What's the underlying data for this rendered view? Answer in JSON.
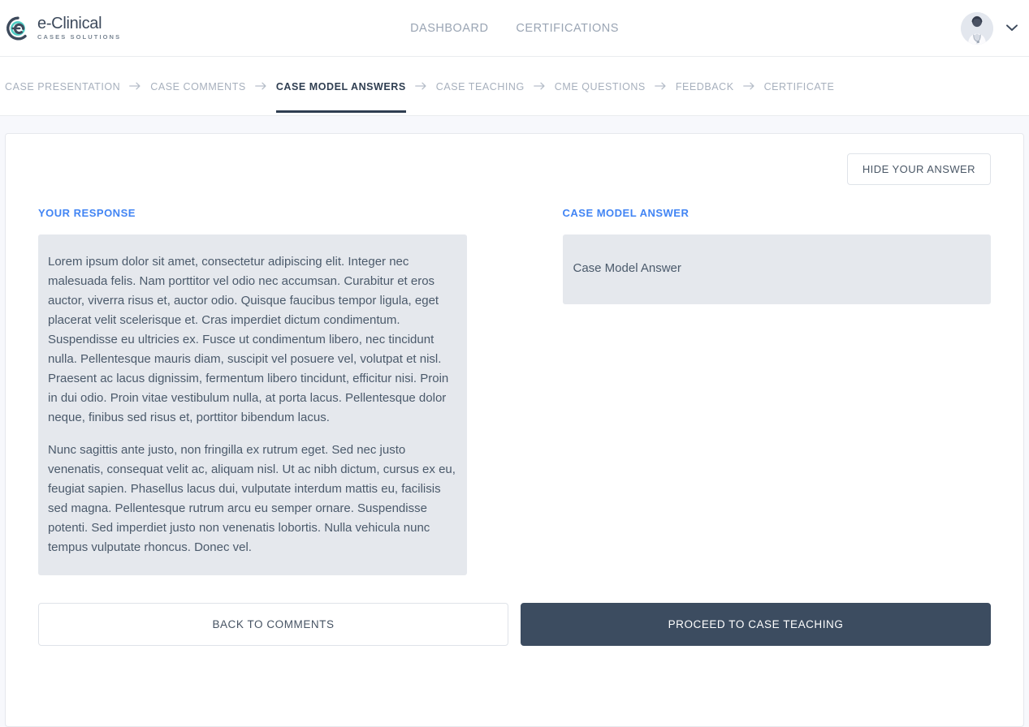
{
  "brand": {
    "name": "e-Clinical",
    "tagline": "CASES SOLUTIONS",
    "icon": "eclinical-logo-icon",
    "ring_color": "#3d4a5c",
    "arc_color": "#4ecdc4"
  },
  "header": {
    "nav": [
      {
        "label": "DASHBOARD"
      },
      {
        "label": "CERTIFICATIONS"
      }
    ],
    "user": {
      "avatar_alt": "doctor-avatar",
      "chevron": "chevron-down-icon"
    },
    "nav_color": "#9aa5b4"
  },
  "breadcrumb": {
    "separator": "arrow-right-icon",
    "items": [
      {
        "label": "CASE PRESENTATION",
        "active": false
      },
      {
        "label": "CASE COMMENTS",
        "active": false
      },
      {
        "label": "CASE MODEL ANSWERS",
        "active": true
      },
      {
        "label": "CASE TEACHING",
        "active": false
      },
      {
        "label": "CME QUESTIONS",
        "active": false
      },
      {
        "label": "FEEDBACK",
        "active": false
      },
      {
        "label": "CERTIFICATE",
        "active": false
      }
    ],
    "active_color": "#2f3e51",
    "inactive_color": "#a7b0bd"
  },
  "toolbar": {
    "hide_answer_label": "HIDE YOUR ANSWER"
  },
  "response": {
    "title": "YOUR RESPONSE",
    "title_color": "#4285f4",
    "paragraphs": [
      "Lorem ipsum dolor sit amet, consectetur adipiscing elit. Integer nec malesuada felis. Nam porttitor vel odio nec accumsan. Curabitur et eros auctor, viverra risus et, auctor odio. Quisque faucibus tempor ligula, eget placerat velit scelerisque et. Cras imperdiet dictum condimentum. Suspendisse eu ultricies ex. Fusce ut condimentum libero, nec tincidunt nulla. Pellentesque mauris diam, suscipit vel posuere vel, volutpat et nisl. Praesent ac lacus dignissim, fermentum libero tincidunt, efficitur nisi. Proin in dui odio. Proin vitae vestibulum nulla, at porta lacus. Pellentesque dolor neque, finibus sed risus et, porttitor bibendum lacus.",
      "Nunc sagittis ante justo, non fringilla ex rutrum eget. Sed nec justo venenatis, consequat velit ac, aliquam nisl. Ut ac nibh dictum, cursus ex eu, feugiat sapien. Phasellus lacus dui, vulputate interdum mattis eu, facilisis sed magna. Pellentesque rutrum arcu eu semper ornare. Suspendisse potenti. Sed imperdiet justo non venenatis lobortis. Nulla vehicula nunc tempus vulputate rhoncus. Donec vel."
    ]
  },
  "model_answer": {
    "title": "CASE MODEL ANSWER",
    "title_color": "#4285f4",
    "body": "Case Model Answer"
  },
  "footer": {
    "back_label": "BACK TO COMMENTS",
    "proceed_label": "PROCEED TO CASE TEACHING",
    "primary_color": "#3c4c60"
  }
}
